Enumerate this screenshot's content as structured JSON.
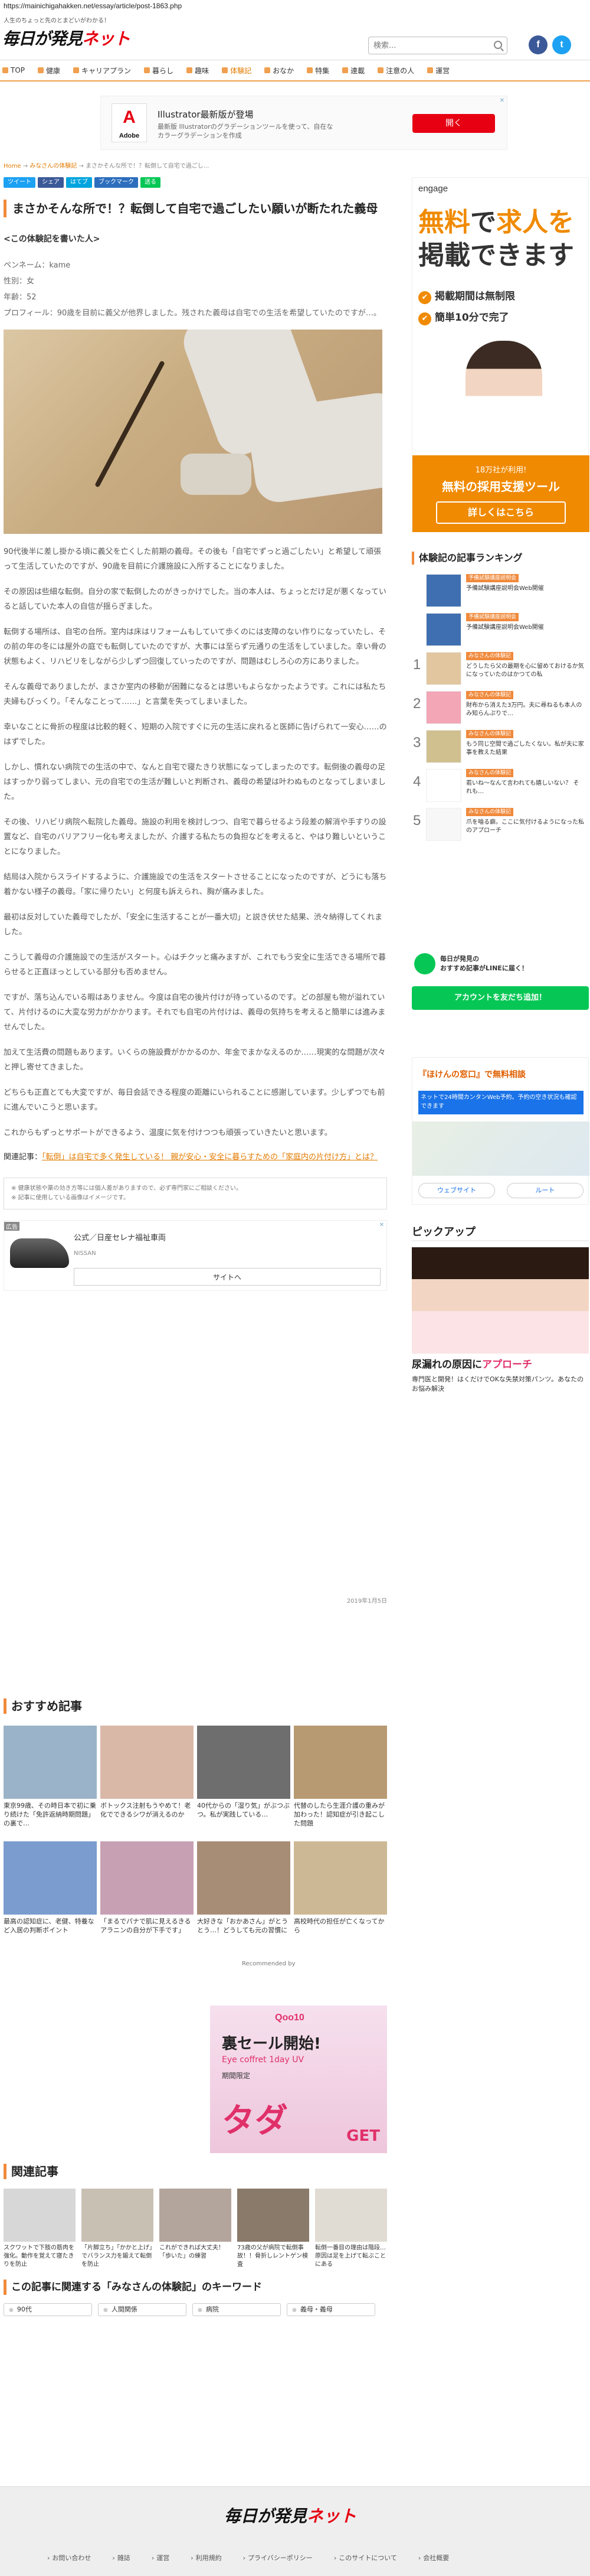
{
  "browser": {
    "url": "https://mainichigahakken.net/essay/article/post-1863.php"
  },
  "header": {
    "tagline": "人生のちょっと先のとまどいがわかる！",
    "logo_main": "毎日が発見",
    "logo_sub": "ネット",
    "search_placeholder": "検索...",
    "social": [
      {
        "icon": "facebook-icon",
        "glyph": "f",
        "color": "#3b5998"
      },
      {
        "icon": "twitter-icon",
        "glyph": "t",
        "color": "#1da1f2"
      }
    ]
  },
  "nav": [
    {
      "label": "TOP",
      "active": false
    },
    {
      "label": "健康",
      "active": false
    },
    {
      "label": "キャリアプラン",
      "active": false
    },
    {
      "label": "暮らし",
      "active": false
    },
    {
      "label": "趣味",
      "active": false
    },
    {
      "label": "体験記",
      "active": true
    },
    {
      "label": "おなか",
      "active": false
    },
    {
      "label": "特集",
      "active": false
    },
    {
      "label": "連載",
      "active": false
    },
    {
      "label": "注意の人",
      "active": false
    },
    {
      "label": "運営",
      "active": false
    }
  ],
  "ad_top": {
    "brand": "Adobe",
    "title": "Illustrator最新版が登場",
    "desc": "最新版 Illustratorのグラデーションツールを使って、自在なカラーグラデーションを作成",
    "cta": "開く",
    "close": "✕"
  },
  "breadcrumb": {
    "home": "Home",
    "sep": "→",
    "category": "みなさんの体験記",
    "current": "まさかそんな所で！？転倒して自宅で過ごし..."
  },
  "share": [
    {
      "label": "ツイート",
      "color": "#1da1f2"
    },
    {
      "label": "シェア",
      "color": "#3b5998"
    },
    {
      "label": "はてブ",
      "color": "#00a4de"
    },
    {
      "label": "ブックマーク",
      "color": "#2c6ebd"
    },
    {
      "label": "送る",
      "color": "#06c755"
    }
  ],
  "article": {
    "title": "まさかそんな所で！？転倒して自宅で過ごしたい願いが断たれた義母",
    "author_heading": "<この体験記を書いた人>",
    "pen_name": "ペンネーム：kame",
    "gender": "性別：女",
    "age": "年齢：52",
    "profile": "プロフィール：90歳を目前に義父が他界しました。残された義母は自宅での生活を希望していたのですが…。",
    "paragraphs": [
      "90代後半に差し掛かる頃に義父を亡くした前期の義母。その後も「自宅でずっと過ごしたい」と希望して頑張って生活していたのですが、90歳を目前に介護施設に入所することになりました。",
      "その原因は些細な転倒。自分の家で転倒したのがきっかけでした。当の本人は、ちょっとだけ足が悪くなっていると話していた本人の自信が揺らぎました。",
      "転倒する場所は、自宅の台所。室内は床はリフォームもしていて歩くのには支障のない作りになっていたし、その前の年の冬には屋外の庭でも転倒していたのですが、大事には至らず元通りの生活をしていました。幸い骨の状態もよく、リハビリをしながら少しずつ回復していったのですが、問題はむしろ心の方にありました。",
      "そんな義母でありましたが、まさか室内の移動が困難になるとは思いもよらなかったようです。これには私たち夫婦もびっくり。「そんなことって……」と言葉を失ってしまいました。",
      "幸いなことに骨折の程度は比較的軽く、短期の入院ですぐに元の生活に戻れると医師に告げられて一安心……のはずでした。",
      "しかし、慣れない病院での生活の中で、なんと自宅で寝たきり状態になってしまったのです。転倒後の義母の足はすっかり弱ってしまい、元の自宅での生活が難しいと判断され、義母の希望は叶わぬものとなってしまいました。",
      "その後、リハビリ病院へ転院した義母。施設の利用を検討しつつ、自宅で暮らせるよう段差の解消や手すりの設置など、自宅のバリアフリー化も考えましたが、介護する私たちの負担などを考えると、やはり難しいということになりました。",
      "結局は入院からスライドするように、介護施設での生活をスタートさせることになったのですが、どうにも落ち着かない様子の義母。「家に帰りたい」と何度も訴えられ、胸が痛みました。",
      "最初は反対していた義母でしたが、「安全に生活することが一番大切」と説き伏せた結果、渋々納得してくれました。",
      "こうして義母の介護施設での生活がスタート。心はチクッと痛みますが、これでもう安全に生活できる場所で暮らせると正直ほっとしている部分も否めません。",
      "ですが、落ち込んでいる暇はありません。今度は自宅の後片付けが待っているのです。どの部屋も物が溢れていて、片付けるのに大変な労力がかかります。それでも自宅の片付けは、義母の気持ちを考えると簡単には進みませんでした。",
      "加えて生活費の問題もあります。いくらの施設費がかかるのか、年金でまかなえるのか……現実的な問題が次々と押し寄せてきました。",
      "どちらも正直とても大変ですが、毎日会話できる程度の距離にいられることに感謝しています。少しずつでも前に進んでいこうと思います。",
      "これからもずっとサポートができるよう、温度に気を付けつつも頑張っていきたいと思います。"
    ],
    "related_label": "関連記事：",
    "related_text": "「転倒」は自宅で多く発生している！ 親が安心・安全に暮らすための「家庭内の片付け方」とは？",
    "notes": [
      "※ 健康状態や薬の効き方等には個人差がありますので、必ず専門家にご相談ください。",
      "※ 記事に使用している画像はイメージです。"
    ],
    "date": "2019年1月5日"
  },
  "ad_inline": {
    "label": "広告",
    "name": "公式／日産セレナ福祉車両",
    "brand": "NISSAN",
    "cta": "サイトへ",
    "close": "✕"
  },
  "recommend": {
    "heading": "おすすめ記事",
    "items": [
      {
        "text": "東京99歳、その時日本で初に乗り続けた「免許返納時期問題」の裏で…",
        "color": "#9bb3c8"
      },
      {
        "text": "ボトックス注射もうやめて！老化でできるシワが消えるのか",
        "color": "#d9b8a8"
      },
      {
        "text": "40代からの「湿り気」がぶつぶつ。私が実践している…",
        "color": "#6e6e6e"
      },
      {
        "text": "代替のしたら生涯介護の重みが加わった！認知症が引き起こした問題",
        "color": "#b89a72"
      },
      {
        "text": "最高の認知症に、老健、特養など入居の判断ポイント",
        "color": "#7a9ccf"
      },
      {
        "text": "「まるでパナで肌に見えるきるアラニンの自分が下手です」",
        "color": "#c8a0b4"
      },
      {
        "text": "大好きな「おかあさん」がとうとう…！どうしても元の習慣に",
        "color": "#a88d76"
      },
      {
        "text": "高校時代の担任が亡くなってから",
        "color": "#cdb896"
      }
    ],
    "powered": "Recommended by"
  },
  "ad_qoo10": {
    "brand": "Qoo10",
    "line1": "裏セール開始!",
    "line2": "Eye coffret 1day UV",
    "line3": "期間限定",
    "line4": "タダ",
    "cta": "GET"
  },
  "kanren": {
    "heading": "関連記事",
    "items": [
      {
        "text": "スクワットで下肢の筋肉を強化。動作を覚えて寝たきりを防止",
        "color": "#d7d7d7"
      },
      {
        "text": "「片脚立ち」「かかと上げ」でバランス力を鍛えて転倒を防止",
        "color": "#c9c0b4"
      },
      {
        "text": "これができれば大丈夫！「歩いた」の練習",
        "color": "#b4a59c"
      },
      {
        "text": "73歳の父が病院で転倒事故！！骨折しレントゲン検査",
        "color": "#8a7a6a"
      },
      {
        "text": "転倒一番目の理由は階段…原因は足を上げて転ぶことにある",
        "color": "#e0dcd4"
      }
    ]
  },
  "keywords": {
    "heading": "この記事に関連する「みなさんの体験記」のキーワード",
    "items": [
      "90代",
      "人間関係",
      "病院",
      "義母・義母"
    ]
  },
  "sidebar": {
    "engage": {
      "logo": "engage",
      "h1a": "無料",
      "h1b": "で",
      "h1c": "求人を",
      "h1d": "掲載できます",
      "checks": [
        "掲載期間は無制限",
        "簡単10分で完了"
      ],
      "foot_a": "18万社が利用!",
      "foot_b": "無料の採用支援ツール",
      "foot_c": "詳しくはこちら"
    },
    "ranking_heading": "体験記の記事ランキング",
    "ranking": [
      {
        "rank": "",
        "cat": "予備試験講座説明会",
        "title": "予備試験講座説明会Web開催",
        "color": "#3f6fb0"
      },
      {
        "rank": "",
        "cat": "予備試験講座説明会",
        "title": "予備試験講座説明会Web開催",
        "color": "#3f6fb0"
      },
      {
        "rank": "1",
        "cat": "みなさんの体験記",
        "title": "どうしたら父の最期を心に留めておけるか気になっていたのはかつての私",
        "color": "#e2c6a0"
      },
      {
        "rank": "2",
        "cat": "みなさんの体験記",
        "title": "財布から消えた3万円。夫に尋ねるも本人のみ知らんぷりで…",
        "color": "#f2a6b6"
      },
      {
        "rank": "3",
        "cat": "みなさんの体験記",
        "title": "もう同じ空間で過ごしたくない。私が夫に家事を教えた結果",
        "color": "#d0c090"
      },
      {
        "rank": "4",
        "cat": "みなさんの体験記",
        "title": "若いね〜なんて言われても嬉しいない？ それも…",
        "color": "#ffffff"
      },
      {
        "rank": "5",
        "cat": "みなさんの体験記",
        "title": "爪を嚙る癖。ここに気付けるようになった私のアプローチ",
        "color": "#f7f7f7"
      }
    ],
    "line_title": "毎日が発見の\nおすすめ記事がLINEに届く！",
    "line_btn": "アカウントを友だち追加！",
    "map_ad": {
      "title": "『ほけんの窓口』で無料相談",
      "bar": "ネットで24時間カンタンWeb予約。予約の空き状況も確認できます",
      "b1": "ウェブサイト",
      "b2": "ルート"
    },
    "pickup": {
      "heading": "ピックアップ",
      "title_a": "尿漏れの原因に",
      "title_b": "アプローチ",
      "sub": "専門医と開発！はくだけでOKな失禁対策パンツ。あなたのお悩み解決"
    }
  },
  "footer": {
    "logo_main": "毎日が発見",
    "logo_sub": "ネット",
    "links": [
      "お問い合わせ",
      "雑誌",
      "運営",
      "利用規約",
      "プライバシーポリシー",
      "このサイトについて",
      "会社概要"
    ]
  }
}
